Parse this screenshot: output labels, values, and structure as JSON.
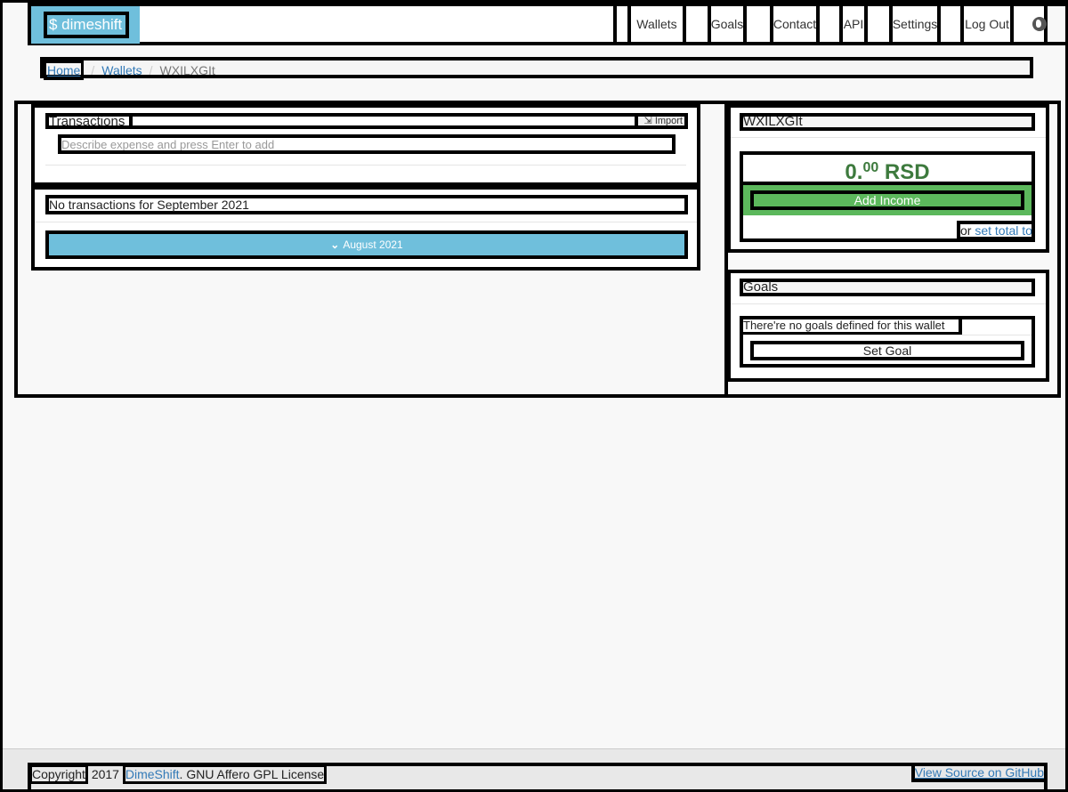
{
  "nav": {
    "brand": "$ dimeshift",
    "items": [
      "Wallets",
      "Goals",
      "Contact",
      "API",
      "Settings",
      "Log Out"
    ],
    "language_icon": "globe-icon"
  },
  "breadcrumb": {
    "home": "Home",
    "wallets": "Wallets",
    "current": "WXILXGIt",
    "separator": "/"
  },
  "transactions": {
    "title": "Transactions",
    "import_label": "Import",
    "input_placeholder": "Describe expense and press Enter to add",
    "empty_message": "No transactions for September 2021",
    "prev_month_label": "August 2021"
  },
  "wallet": {
    "name": "WXILXGIt",
    "balance_int": "0.",
    "balance_dec": "00",
    "currency": "RSD",
    "add_income_label": "Add Income",
    "or_label": "or",
    "set_total_label": "set total to"
  },
  "goals": {
    "title": "Goals",
    "empty_message": "There're no goals defined for this wallet",
    "set_goal_label": "Set Goal"
  },
  "footer": {
    "copyright": "Copyright",
    "year": "2017",
    "link": "DimeShift",
    "license": ". GNU Affero GPL License",
    "github": "View Source on GitHub"
  },
  "colors": {
    "brand": "#6fbfdc",
    "success": "#5cb85c",
    "balance": "#3d7a3d",
    "link": "#337ab7"
  }
}
